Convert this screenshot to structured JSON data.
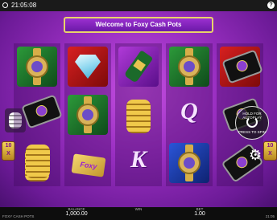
{
  "topbar": {
    "time": "21:05:08",
    "help_label": "?"
  },
  "banner": {
    "text": "Welcome to Foxy Cash Pots"
  },
  "reels": [
    [
      "watch-gold",
      "watch-green",
      "watch-red"
    ],
    [
      "diamond",
      "watch-green",
      "foxy-card"
    ],
    [
      "champagne",
      "gold-coins",
      "K"
    ],
    [
      "phone-gold",
      "Q",
      "watch-blue"
    ],
    [
      "phone-diamond",
      "phone-black",
      "phone-gold"
    ]
  ],
  "side_badges": {
    "left": "10\nX",
    "right": "10\nX"
  },
  "symbol_text": {
    "card": "Foxy",
    "letter_k": "K",
    "letter_q": "Q"
  },
  "autoplay": {
    "label": "HOLD FOR AUTOPLAY",
    "sub_label": "PRESS TO SPIN"
  },
  "footer": {
    "balance_label": "BALANCE",
    "balance_value": "1,000.00",
    "win_label": "WIN",
    "win_value": "",
    "bet_label": "BET",
    "bet_value": "1.00",
    "brand": "FOXY CASH POTS",
    "time": "21:05"
  }
}
